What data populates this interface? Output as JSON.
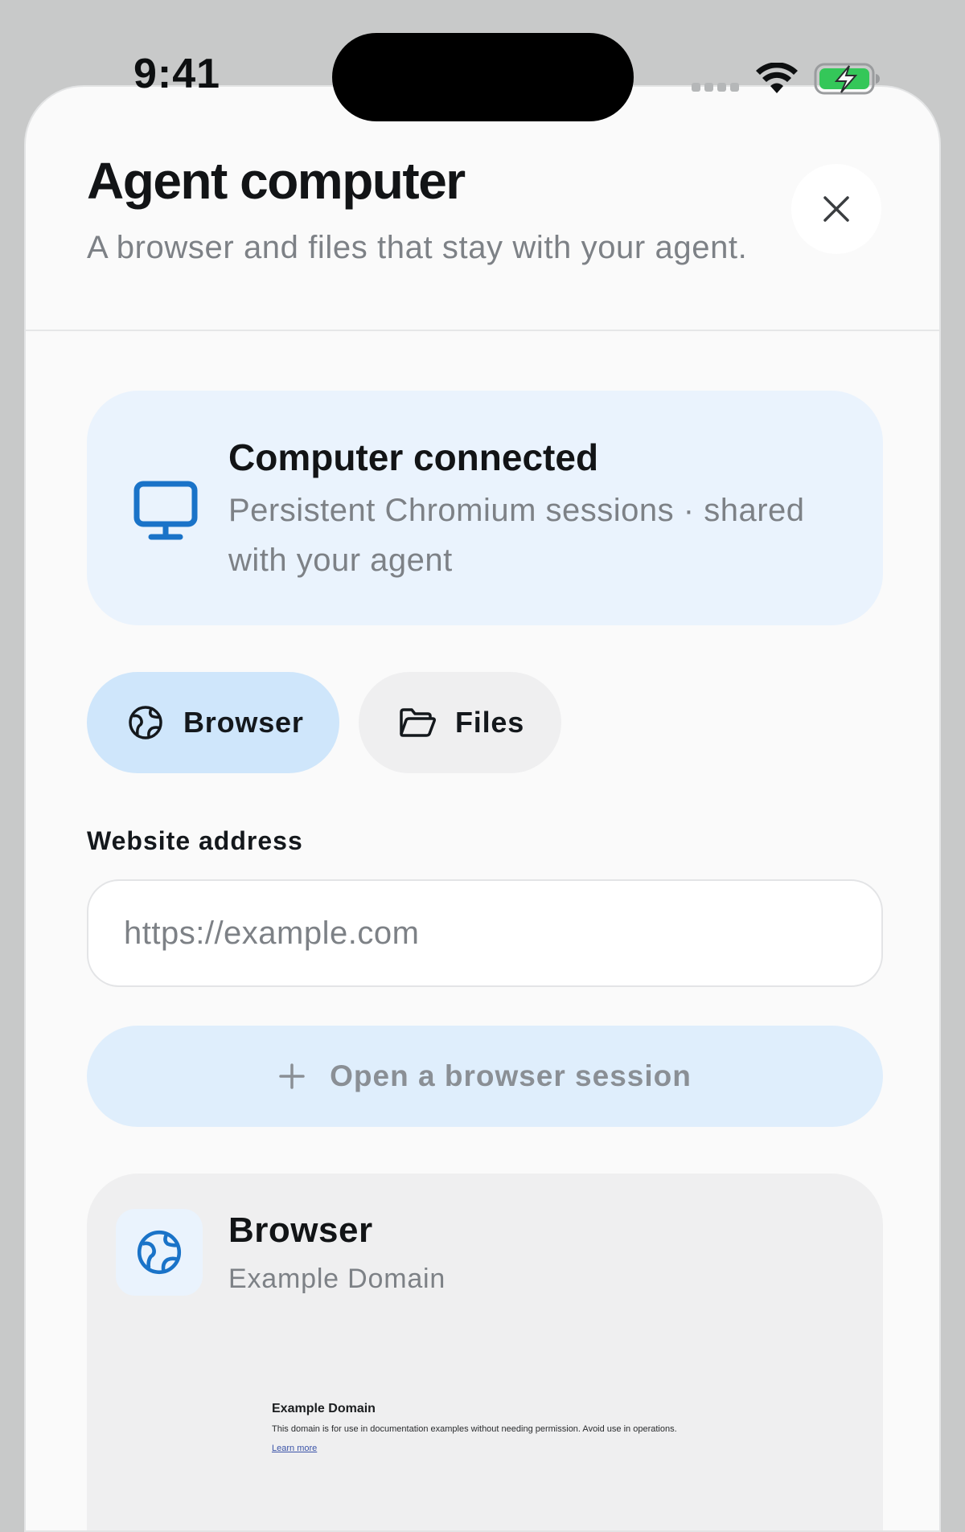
{
  "status_bar": {
    "time": "9:41"
  },
  "sheet": {
    "title": "Agent computer",
    "subtitle": "A browser and files that stay with your agent.",
    "close_icon": "close-icon"
  },
  "connection": {
    "title": "Computer connected",
    "description": "Persistent Chromium sessions · shared with your agent",
    "icon": "monitor-icon"
  },
  "tabs": [
    {
      "label": "Browser",
      "icon": "globe-icon",
      "selected": true
    },
    {
      "label": "Files",
      "icon": "folder-icon",
      "selected": false
    }
  ],
  "address": {
    "label": "Website address",
    "placeholder": "https://example.com",
    "value": ""
  },
  "open_session": {
    "label": "Open a browser session",
    "icon": "plus-icon"
  },
  "session": {
    "title": "Browser",
    "subtitle": "Example Domain",
    "icon": "globe-icon",
    "preview": {
      "heading": "Example Domain",
      "text": "This domain is for use in documentation examples without needing permission. Avoid use in operations.",
      "link": "Learn more"
    }
  },
  "colors": {
    "accent": "#1a73c8",
    "selected_tab": "#cfe6fb",
    "card_blue": "#eaf3fd",
    "sheet_bg": "#fafafa",
    "battery_green": "#34c759"
  }
}
